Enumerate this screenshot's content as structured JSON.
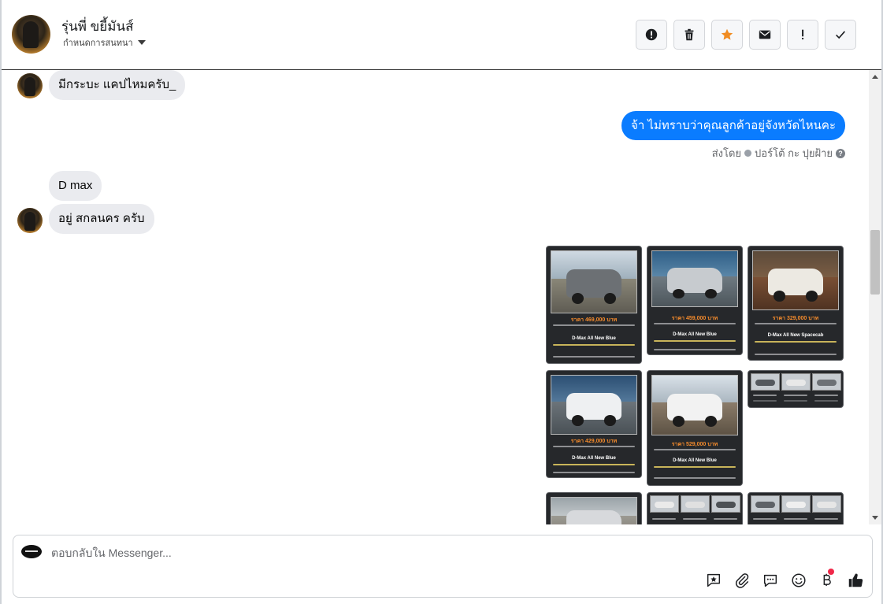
{
  "header": {
    "contact_name": "รุ่นพี่ ขยี้มันส์",
    "assign_label": "กำหนดการสนทนา",
    "actions": [
      "report-icon",
      "trash-icon",
      "star-icon",
      "mail-icon",
      "exclamation-icon",
      "check-icon"
    ]
  },
  "messages": {
    "m1": "มีกระบะ แคปไหมครับ_",
    "m2": "จ้า ไม่ทราบว่าคุณลูกค้าอยู่จังหวัดไหนคะ",
    "m2_sent_by_prefix": "ส่งโดย",
    "m2_sent_by_name": "ปอร์โต้ กะ ปุยฝ้าย",
    "m3": "D max",
    "m4": "อยู่ สกลนคร ครับ"
  },
  "cards": [
    {
      "price": "ราคา 469,000 บาท",
      "model": "D-Max All New Blue"
    },
    {
      "price": "ราคา 459,000 บาท",
      "model": "D-Max All New Blue"
    },
    {
      "price": "ราคา 329,000 บาท",
      "model": "D-Max All New Spacecab"
    },
    {
      "price": "ราคา 429,000 บาท",
      "model": "D-Max All New Blue"
    },
    {
      "price": "ราคา 529,000 บาท",
      "model": "D-Max All New Blue"
    }
  ],
  "composer": {
    "placeholder": "ตอบกลับใน Messenger..."
  },
  "colors": {
    "outgoing_bubble": "#0a7cff",
    "incoming_bubble": "#eaebef",
    "star": "#f08c22",
    "like": "#050505"
  }
}
